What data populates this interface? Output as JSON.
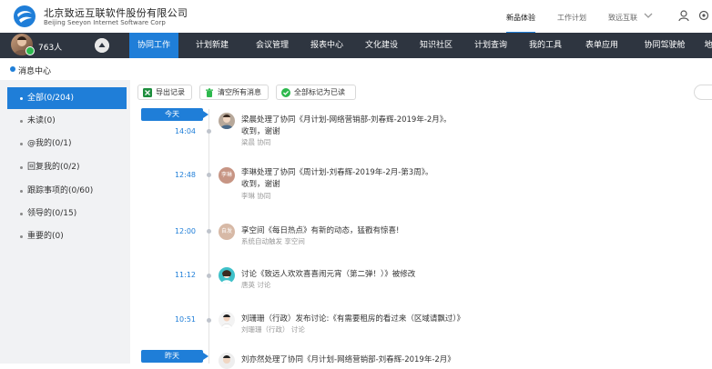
{
  "header": {
    "company_cn": "北京致远互联软件股份有限公司",
    "company_en": "Beijing Seeyon Internet Software Corp",
    "links": [
      "新品体验",
      "工作计划",
      "致远互联"
    ]
  },
  "user": {
    "count": "763人"
  },
  "nav": [
    "协同工作",
    "计划新建",
    "会议管理",
    "报表中心",
    "文化建设",
    "知识社区",
    "计划查询",
    "我的工具",
    "表单应用",
    "协同驾驶舱",
    "地"
  ],
  "breadcrumb": "消息中心",
  "sidebar": [
    "全部(0/204)",
    "未读(0)",
    "@我的(0/1)",
    "回复我的(0/2)",
    "跟踪事项的(0/60)",
    "领导的(0/15)",
    "重要的(0)"
  ],
  "toolbar": {
    "export": "导出记录",
    "clear": "清空所有消息",
    "mark_read": "全部标记为已读"
  },
  "timeline": {
    "today": "今天",
    "yesterday": "昨天",
    "entries": [
      {
        "time": "14:04",
        "avatar_text": "",
        "title": "梁晨处理了协同《月计划-网络营销部-刘春辉-2019年-2月》。",
        "body": "收到，谢谢",
        "meta": "梁晨 协同"
      },
      {
        "time": "12:48",
        "avatar_text": "李琳",
        "title": "李琳处理了协同《周计划-刘春辉-2019年-2月-第3周》。",
        "body": "收到，谢谢",
        "meta": "李琳 协同"
      },
      {
        "time": "12:00",
        "avatar_text": "自发",
        "title": "享空间《每日热点》有新的动态，猛戳有惊喜!",
        "body": "",
        "meta": "系统自动触发 享空间"
      },
      {
        "time": "11:12",
        "avatar_text": "",
        "title": "讨论《致远人欢欢喜喜闹元宵（第二弹！）》被修改",
        "body": "",
        "meta": "唐英 讨论"
      },
      {
        "time": "10:51",
        "avatar_text": "",
        "title": "刘珊珊（行政）发布讨论:《有需要租房的看过来（区域请飘过）》",
        "body": "",
        "meta": "刘珊珊（行政） 讨论"
      },
      {
        "time": "",
        "avatar_text": "",
        "title": "刘亦然处理了协同《月计划-网络营销部-刘春辉-2019年-2月》",
        "body": "",
        "meta": ""
      }
    ]
  }
}
